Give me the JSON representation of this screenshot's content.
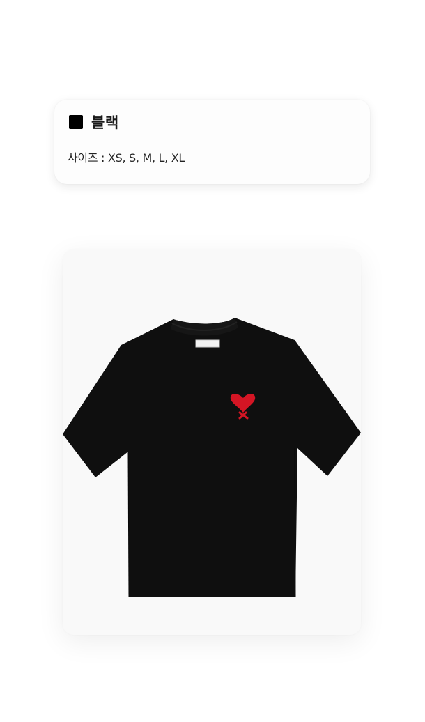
{
  "option": {
    "color_swatch": "#000000",
    "color_name": "블랙",
    "size_text": "사이즈 : XS, S, M, L, XL"
  },
  "product_image": {
    "shirt_color": "#0f0f0f",
    "logo_color": "#d41524",
    "logo_type": "heart-a-icon"
  }
}
